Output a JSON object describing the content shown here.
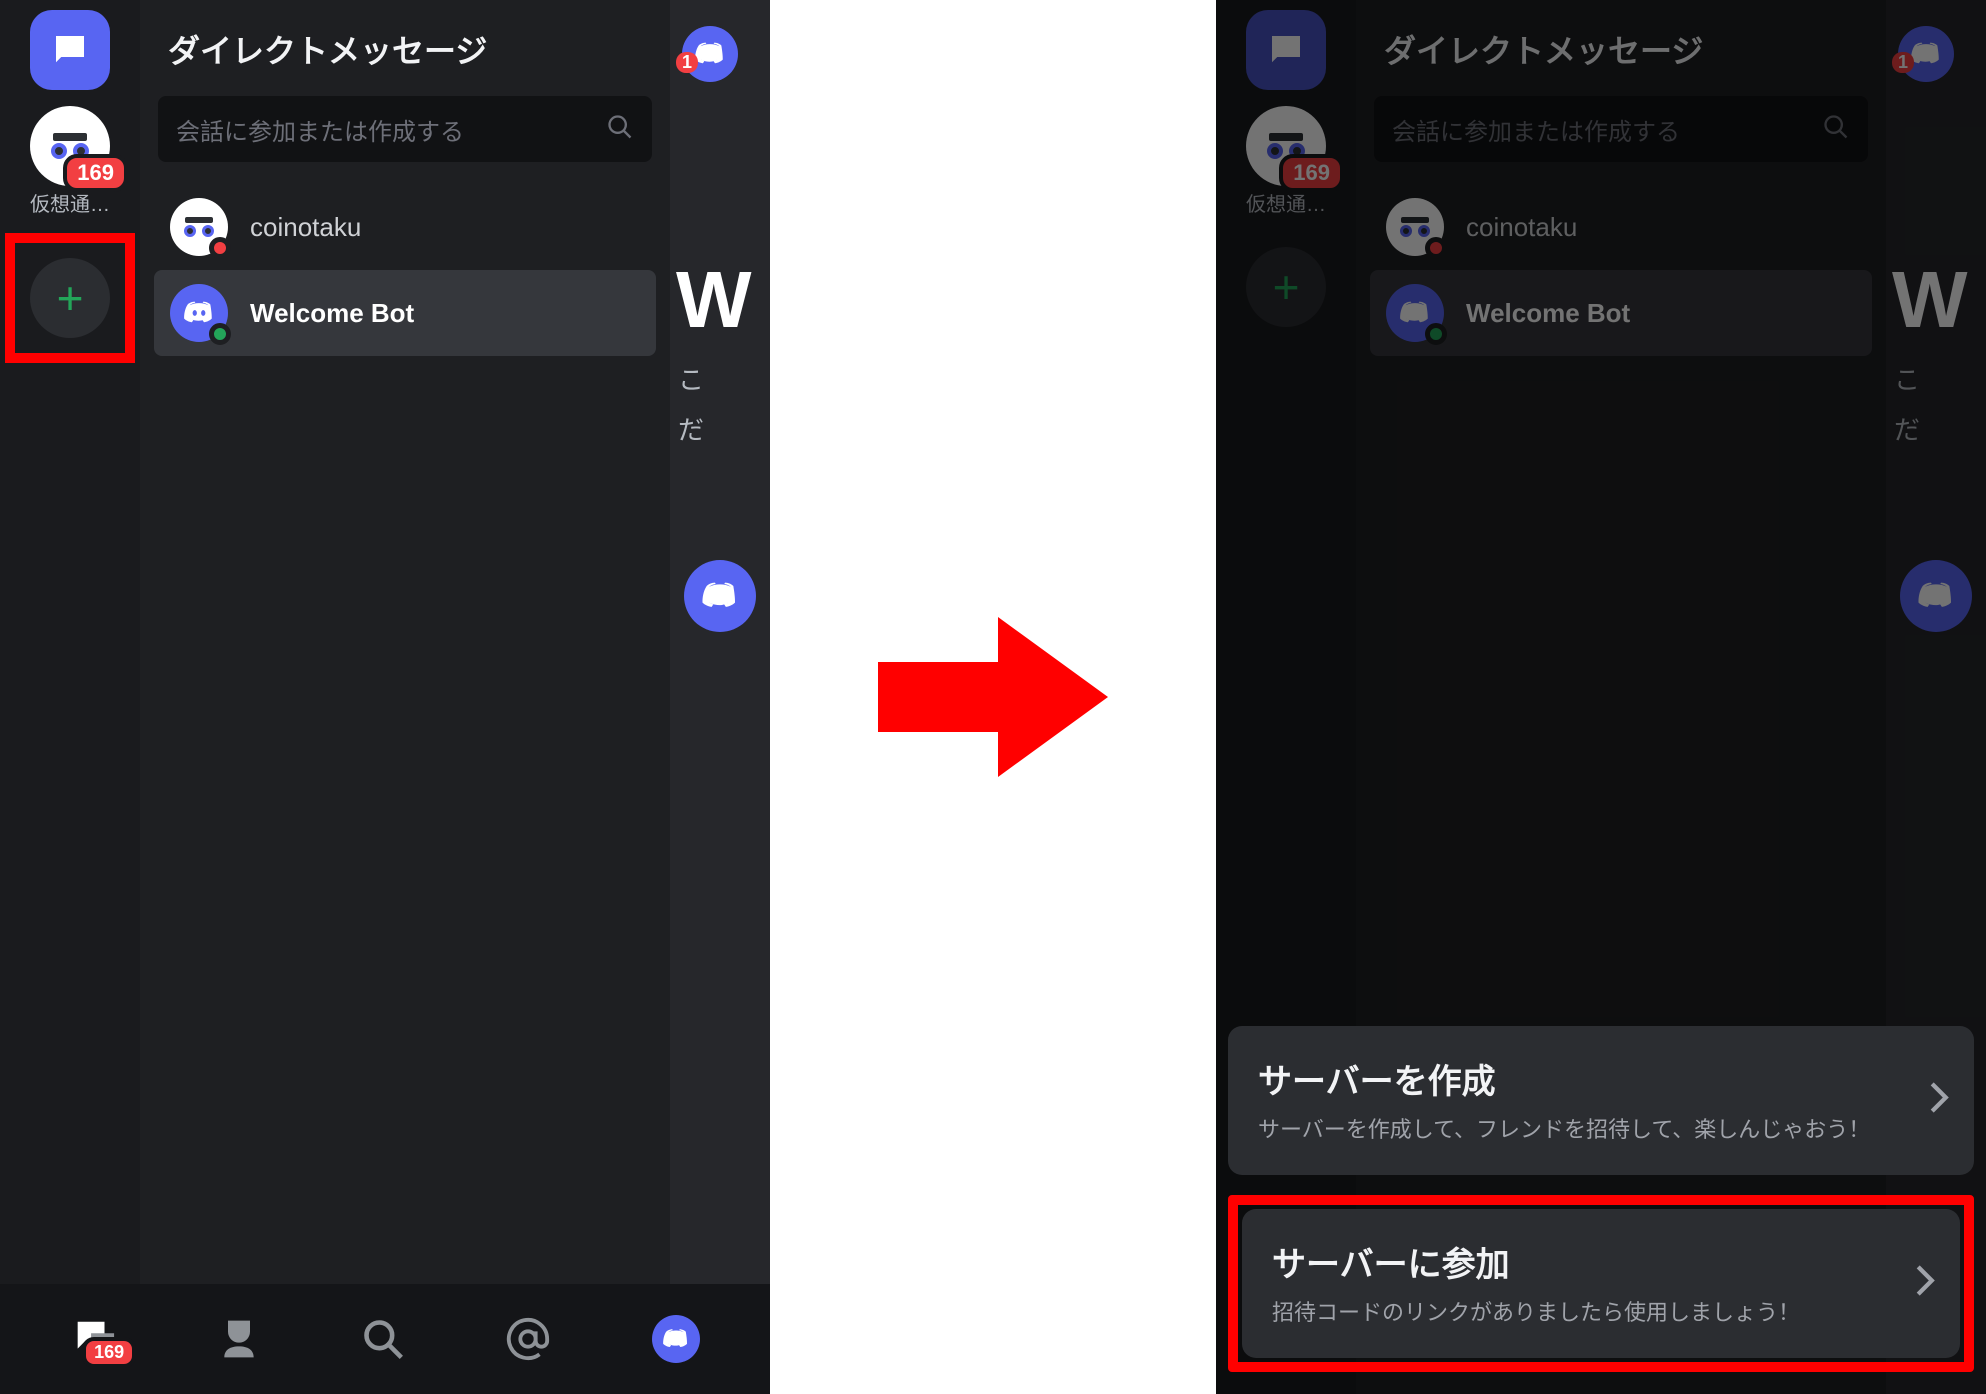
{
  "left": {
    "dm_title": "ダイレクトメッセージ",
    "search_placeholder": "会話に参加または作成する",
    "server_badge": "169",
    "server_label": "仮想通…",
    "dm_items": [
      {
        "name": "coinotaku"
      },
      {
        "name": "Welcome Bot"
      }
    ],
    "peek": {
      "W": "W",
      "line1": "こ",
      "line2": "だ"
    },
    "nav_badge": "169"
  },
  "right": {
    "dm_title": "ダイレクトメッセージ",
    "search_placeholder": "会話に参加または作成する",
    "server_badge": "169",
    "server_label": "仮想通…",
    "dm_items": [
      {
        "name": "coinotaku"
      },
      {
        "name": "Welcome Bot"
      }
    ],
    "peek": {
      "W": "W",
      "line1": "こ",
      "line2": "だ"
    },
    "sheet": {
      "create_title": "サーバーを作成",
      "create_sub": "サーバーを作成して、フレンドを招待して、楽しんじゃおう！",
      "join_title": "サーバーに参加",
      "join_sub": "招待コードのリンクがありましたら使用しましょう！"
    }
  }
}
